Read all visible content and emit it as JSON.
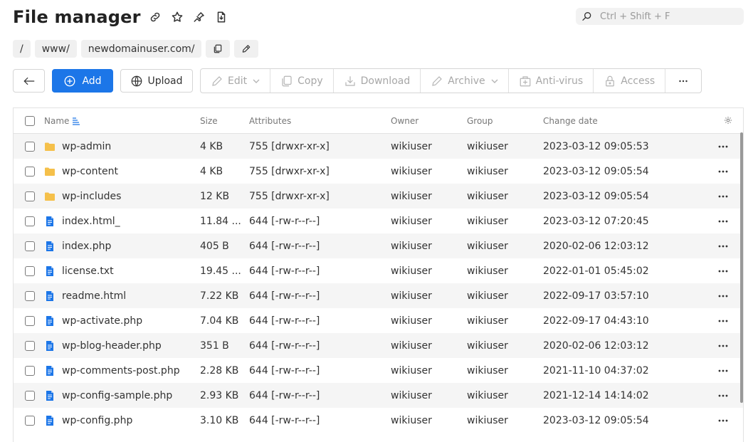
{
  "header": {
    "title": "File manager"
  },
  "search": {
    "placeholder": "Ctrl + Shift + F"
  },
  "breadcrumbs": [
    "/",
    "www/",
    "newdomainuser.com/"
  ],
  "toolbar": {
    "add_label": "Add",
    "upload_label": "Upload",
    "actions": [
      {
        "label": "Edit",
        "icon": "pencil-icon",
        "dropdown": true
      },
      {
        "label": "Copy",
        "icon": "copy-icon",
        "dropdown": false
      },
      {
        "label": "Download",
        "icon": "download-icon",
        "dropdown": false
      },
      {
        "label": "Archive",
        "icon": "archive-icon",
        "dropdown": true
      },
      {
        "label": "Anti-virus",
        "icon": "antivirus-icon",
        "dropdown": false
      },
      {
        "label": "Access",
        "icon": "lock-icon",
        "dropdown": false
      }
    ]
  },
  "table": {
    "columns": {
      "name": "Name",
      "size": "Size",
      "attributes": "Attributes",
      "owner": "Owner",
      "group": "Group",
      "date": "Change date"
    },
    "rows": [
      {
        "type": "folder",
        "name": "wp-admin",
        "size": "4 KB",
        "attributes": "755 [drwxr-xr-x]",
        "owner": "wikiuser",
        "group": "wikiuser",
        "date": "2023-03-12 09:05:53"
      },
      {
        "type": "folder",
        "name": "wp-content",
        "size": "4 KB",
        "attributes": "755 [drwxr-xr-x]",
        "owner": "wikiuser",
        "group": "wikiuser",
        "date": "2023-03-12 09:05:54"
      },
      {
        "type": "folder",
        "name": "wp-includes",
        "size": "12 KB",
        "attributes": "755 [drwxr-xr-x]",
        "owner": "wikiuser",
        "group": "wikiuser",
        "date": "2023-03-12 09:05:54"
      },
      {
        "type": "file",
        "name": "index.html_",
        "size": "11.84 ...",
        "attributes": "644 [-rw-r--r--]",
        "owner": "wikiuser",
        "group": "wikiuser",
        "date": "2023-03-12 07:20:45"
      },
      {
        "type": "file",
        "name": "index.php",
        "size": "405 B",
        "attributes": "644 [-rw-r--r--]",
        "owner": "wikiuser",
        "group": "wikiuser",
        "date": "2020-02-06 12:03:12"
      },
      {
        "type": "file",
        "name": "license.txt",
        "size": "19.45 ...",
        "attributes": "644 [-rw-r--r--]",
        "owner": "wikiuser",
        "group": "wikiuser",
        "date": "2022-01-01 05:45:02"
      },
      {
        "type": "file",
        "name": "readme.html",
        "size": "7.22 KB",
        "attributes": "644 [-rw-r--r--]",
        "owner": "wikiuser",
        "group": "wikiuser",
        "date": "2022-09-17 03:57:10"
      },
      {
        "type": "file",
        "name": "wp-activate.php",
        "size": "7.04 KB",
        "attributes": "644 [-rw-r--r--]",
        "owner": "wikiuser",
        "group": "wikiuser",
        "date": "2022-09-17 04:43:10"
      },
      {
        "type": "file",
        "name": "wp-blog-header.php",
        "size": "351 B",
        "attributes": "644 [-rw-r--r--]",
        "owner": "wikiuser",
        "group": "wikiuser",
        "date": "2020-02-06 12:03:12"
      },
      {
        "type": "file",
        "name": "wp-comments-post.php",
        "size": "2.28 KB",
        "attributes": "644 [-rw-r--r--]",
        "owner": "wikiuser",
        "group": "wikiuser",
        "date": "2021-11-10 04:37:02"
      },
      {
        "type": "file",
        "name": "wp-config-sample.php",
        "size": "2.93 KB",
        "attributes": "644 [-rw-r--r--]",
        "owner": "wikiuser",
        "group": "wikiuser",
        "date": "2021-12-14 14:14:02"
      },
      {
        "type": "file",
        "name": "wp-config.php",
        "size": "3.10 KB",
        "attributes": "644 [-rw-r--r--]",
        "owner": "wikiuser",
        "group": "wikiuser",
        "date": "2023-03-12 09:05:54"
      }
    ]
  },
  "colors": {
    "accent": "#1c76e8",
    "folder": "#f5c04a",
    "file": "#1c76e8",
    "row_alt": "#f5f5f5"
  }
}
